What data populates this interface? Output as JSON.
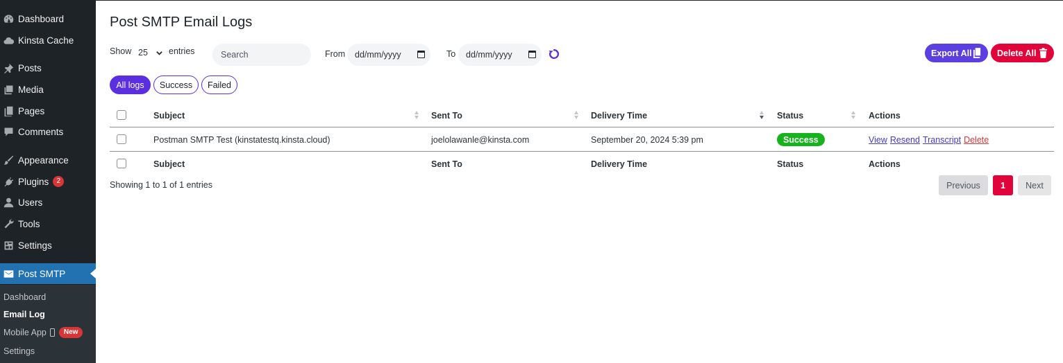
{
  "sidebar": {
    "items": [
      {
        "label": "Dashboard",
        "icon": "dashboard-icon"
      },
      {
        "label": "Kinsta Cache",
        "icon": "cloud-icon"
      },
      {
        "label": "Posts",
        "icon": "pin-icon"
      },
      {
        "label": "Media",
        "icon": "media-icon"
      },
      {
        "label": "Pages",
        "icon": "pages-icon"
      },
      {
        "label": "Comments",
        "icon": "comment-icon"
      },
      {
        "label": "Appearance",
        "icon": "brush-icon"
      },
      {
        "label": "Plugins",
        "icon": "plug-icon",
        "badge": "2"
      },
      {
        "label": "Users",
        "icon": "user-icon"
      },
      {
        "label": "Tools",
        "icon": "wrench-icon"
      },
      {
        "label": "Settings",
        "icon": "settings-icon"
      },
      {
        "label": "Post SMTP",
        "icon": "envelope-icon"
      }
    ],
    "submenu": [
      {
        "label": "Dashboard"
      },
      {
        "label": "Email Log"
      },
      {
        "label": "Mobile App",
        "badge": "New"
      },
      {
        "label": "Settings"
      }
    ]
  },
  "page": {
    "title": "Post SMTP Email Logs"
  },
  "controls": {
    "show_label": "Show",
    "show_value": "25",
    "entries_label": "entries",
    "search_placeholder": "Search",
    "from_label": "From",
    "from_placeholder": "dd/mm/yyyy",
    "to_label": "To",
    "to_placeholder": "dd/mm/yyyy",
    "export_label": "Export All",
    "delete_all_label": "Delete All"
  },
  "filters": [
    "All logs",
    "Success",
    "Failed"
  ],
  "table": {
    "columns": [
      "Subject",
      "Sent To",
      "Delivery Time",
      "Status",
      "Actions"
    ],
    "rows": [
      {
        "subject": "Postman SMTP Test (kinstatestq.kinsta.cloud)",
        "sent_to": "joelolawanle@kinsta.com",
        "delivery_time": "September 20, 2024 5:39 pm",
        "status": "Success",
        "actions": [
          "View",
          "Resend",
          "Transcript",
          "Delete"
        ]
      }
    ]
  },
  "footer": {
    "info": "Showing 1 to 1 of 1 entries",
    "previous": "Previous",
    "page": "1",
    "next": "Next"
  },
  "colors": {
    "sidebar_bg": "#1d2327",
    "active_menu": "#2271b1",
    "accent_purple": "#5b2fe0",
    "danger_red": "#e0043b",
    "success_green": "#17b31f"
  }
}
